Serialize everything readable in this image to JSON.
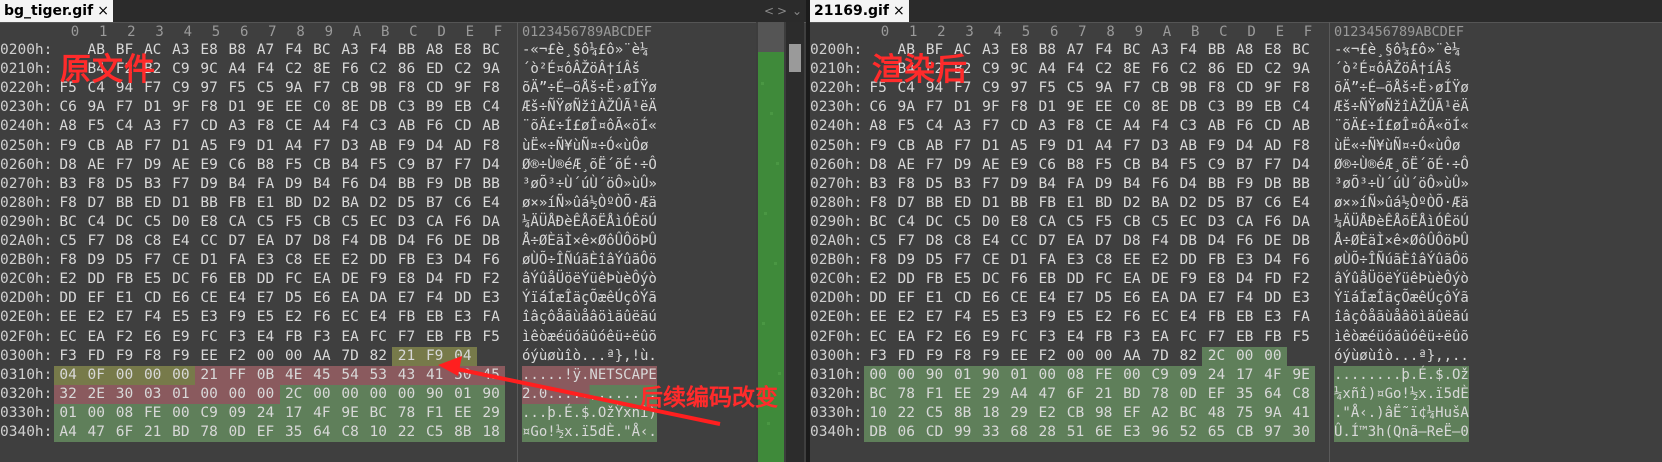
{
  "left": {
    "tab_label": "bg_tiger.gif",
    "tab_close": "×",
    "overlay_title": "原文件",
    "annotation": "后续编码改变",
    "controls": {
      "prev": "<",
      "next": ">",
      "menu": "⌄"
    },
    "col_headers": [
      "0",
      "1",
      "2",
      "3",
      "4",
      "5",
      "6",
      "7",
      "8",
      "9",
      "A",
      "B",
      "C",
      "D",
      "E",
      "F"
    ],
    "ascii_header": "0123456789ABCDEF",
    "rows": [
      {
        "off": "0200h:",
        "hex": [
          "AB",
          "BF",
          "AC",
          "A3",
          "E8",
          "B8",
          "A7",
          "F4",
          "BC",
          "A3",
          "F4",
          "BB",
          "A8",
          "E8",
          "BC"
        ],
        "ascii": "-«¬£è¸§ô¼£ô»¨è¼"
      },
      {
        "off": "0210h:",
        "hex": [
          "B4",
          "F2",
          "B2",
          "C9",
          "9C",
          "A4",
          "F4",
          "C2",
          "8E",
          "F6",
          "C2",
          "86",
          "ED",
          "C2",
          "9A"
        ],
        "ascii": "´ò²É­¤ôÂŽöÂ†íÂš"
      },
      {
        "off": "0220h:",
        "hex": [
          "F5",
          "C4",
          "94",
          "F7",
          "C9",
          "97",
          "F5",
          "C5",
          "9A",
          "F7",
          "CB",
          "9B",
          "F8",
          "CD",
          "9F",
          "F8"
        ],
        "ascii": "õÄ”÷É—õÅš÷Ë›øÍŸø"
      },
      {
        "off": "0230h:",
        "hex": [
          "C6",
          "9A",
          "F7",
          "D1",
          "9F",
          "F8",
          "D1",
          "9E",
          "EE",
          "C0",
          "8E",
          "DB",
          "C3",
          "B9",
          "EB",
          "C4"
        ],
        "ascii": "Æš÷ÑŸøÑžîÀŽÛÃ¹ëÄ"
      },
      {
        "off": "0240h:",
        "hex": [
          "A8",
          "F5",
          "C4",
          "A3",
          "F7",
          "CD",
          "A3",
          "F8",
          "CE",
          "A4",
          "F4",
          "C3",
          "AB",
          "F6",
          "CD",
          "AB"
        ],
        "ascii": "¨õÄ£÷Í£øÎ¤ôÃ«öÍ«"
      },
      {
        "off": "0250h:",
        "hex": [
          "F9",
          "CB",
          "AB",
          "F7",
          "D1",
          "A5",
          "F9",
          "D1",
          "A4",
          "F7",
          "D3",
          "AB",
          "F9",
          "D4",
          "AD",
          "F8"
        ],
        "ascii": "ùË«÷Ñ¥ùÑ¤÷Ó«ùÔ­ø"
      },
      {
        "off": "0260h:",
        "hex": [
          "D8",
          "AE",
          "F7",
          "D9",
          "AE",
          "E9",
          "C6",
          "B8",
          "F5",
          "CB",
          "B4",
          "F5",
          "C9",
          "B7",
          "F7",
          "D4"
        ],
        "ascii": "Ø®÷Ù®éÆ¸õË´õÉ·÷Ô"
      },
      {
        "off": "0270h:",
        "hex": [
          "B3",
          "F8",
          "D5",
          "B3",
          "F7",
          "D9",
          "B4",
          "FA",
          "D9",
          "B4",
          "F6",
          "D4",
          "BB",
          "F9",
          "DB",
          "BB"
        ],
        "ascii": "³øÕ³÷Ù´úÙ´öÔ»ùÛ»"
      },
      {
        "off": "0280h:",
        "hex": [
          "F8",
          "D7",
          "BB",
          "ED",
          "D1",
          "BB",
          "FB",
          "E1",
          "BD",
          "D2",
          "BA",
          "D2",
          "D5",
          "B7",
          "C6",
          "E4"
        ],
        "ascii": "ø×»íÑ»ûá½ÒºÒÕ·Æä"
      },
      {
        "off": "0290h:",
        "hex": [
          "BC",
          "C4",
          "DC",
          "C5",
          "D0",
          "E8",
          "CA",
          "C5",
          "F5",
          "CB",
          "C5",
          "EC",
          "D3",
          "CA",
          "F6",
          "DA"
        ],
        "ascii": "¼ÄÜÅÐèÊÅõËÅìÓÊöÚ"
      },
      {
        "off": "02A0h:",
        "hex": [
          "C5",
          "F7",
          "D8",
          "C8",
          "E4",
          "CC",
          "D7",
          "EA",
          "D7",
          "D8",
          "F4",
          "DB",
          "D4",
          "F6",
          "DE",
          "DB"
        ],
        "ascii": "Å÷ØÈäÌ×ê×ØôÛÔöÞÛ"
      },
      {
        "off": "02B0h:",
        "hex": [
          "F8",
          "D9",
          "D5",
          "F7",
          "CE",
          "D1",
          "FA",
          "E3",
          "C8",
          "EE",
          "E2",
          "DD",
          "FB",
          "E3",
          "D4",
          "F6"
        ],
        "ascii": "øÙÕ÷ÎÑúãÈîâÝûãÔö"
      },
      {
        "off": "02C0h:",
        "hex": [
          "E2",
          "DD",
          "FB",
          "E5",
          "DC",
          "F6",
          "EB",
          "DD",
          "FC",
          "EA",
          "DE",
          "F9",
          "E8",
          "D4",
          "FD",
          "F2"
        ],
        "ascii": "âÝûåÜöëÝüêÞùèÔýò"
      },
      {
        "off": "02D0h:",
        "hex": [
          "DD",
          "EF",
          "E1",
          "CD",
          "E6",
          "CE",
          "E4",
          "E7",
          "D5",
          "E6",
          "EA",
          "DA",
          "E7",
          "F4",
          "DD",
          "E3"
        ],
        "ascii": "ÝïáÍæÎäçÕæêÚçôÝã"
      },
      {
        "off": "02E0h:",
        "hex": [
          "EE",
          "E2",
          "E7",
          "F4",
          "E5",
          "E3",
          "F9",
          "E5",
          "E2",
          "F6",
          "EC",
          "E4",
          "FB",
          "EB",
          "E3",
          "FA"
        ],
        "ascii": "îâçôåãùåâöìäûëãú"
      },
      {
        "off": "02F0h:",
        "hex": [
          "EC",
          "EA",
          "F2",
          "E6",
          "E9",
          "FC",
          "F3",
          "E4",
          "FB",
          "F3",
          "EA",
          "FC",
          "F7",
          "EB",
          "FB",
          "F5"
        ],
        "ascii": "ìêòæéüóäûóêü÷ëûõ"
      },
      {
        "off": "0300h:",
        "hex": [
          "F3",
          "FD",
          "F9",
          "F8",
          "F9",
          "EE",
          "F2",
          "00",
          "00",
          "AA",
          "7D",
          "82",
          "21",
          "F9",
          "04"
        ],
        "ascii": "óýùøùîò...ª}‚!ù."
      },
      {
        "off": "0310h:",
        "hex": [
          "04",
          "0F",
          "00",
          "00",
          "00",
          "21",
          "FF",
          "0B",
          "4E",
          "45",
          "54",
          "53",
          "43",
          "41",
          "50",
          "45"
        ],
        "ascii": ".....!ÿ.NETSCAPE"
      },
      {
        "off": "0320h:",
        "hex": [
          "32",
          "2E",
          "30",
          "03",
          "01",
          "00",
          "00",
          "00",
          "2C",
          "00",
          "00",
          "00",
          "00",
          "90",
          "01",
          "90"
        ],
        "ascii": "2.0.....,......."
      },
      {
        "off": "0330h:",
        "hex": [
          "01",
          "00",
          "08",
          "FE",
          "00",
          "C9",
          "09",
          "24",
          "17",
          "4F",
          "9E",
          "BC",
          "78",
          "F1",
          "EE",
          "29"
        ],
        "ascii": "...þ.É.$.OžŸxñî)"
      },
      {
        "off": "0340h:",
        "hex": [
          "A4",
          "47",
          "6F",
          "21",
          "BD",
          "78",
          "0D",
          "EF",
          "35",
          "64",
          "C8",
          "10",
          "22",
          "C5",
          "8B",
          "18"
        ],
        "ascii": "¤Go!½x.ï5dÈ.\"Å‹."
      }
    ]
  },
  "right": {
    "tab_label": "21169.gif",
    "tab_close": "×",
    "overlay_title": "渲染后",
    "col_headers": [
      "0",
      "1",
      "2",
      "3",
      "4",
      "5",
      "6",
      "7",
      "8",
      "9",
      "A",
      "B",
      "C",
      "D",
      "E",
      "F"
    ],
    "ascii_header": "0123456789ABCDEF",
    "rows": [
      {
        "off": "0200h:",
        "hex": [
          "AB",
          "BF",
          "AC",
          "A3",
          "E8",
          "B8",
          "A7",
          "F4",
          "BC",
          "A3",
          "F4",
          "BB",
          "A8",
          "E8",
          "BC"
        ],
        "ascii": "-«¬£è¸§ô¼£ô»¨è¼"
      },
      {
        "off": "0210h:",
        "hex": [
          "B4",
          "F2",
          "B2",
          "C9",
          "9C",
          "A4",
          "F4",
          "C2",
          "8E",
          "F6",
          "C2",
          "86",
          "ED",
          "C2",
          "9A"
        ],
        "ascii": "´ò²É­¤ôÂŽöÂ†íÂš"
      },
      {
        "off": "0220h:",
        "hex": [
          "F5",
          "C4",
          "94",
          "F7",
          "C9",
          "97",
          "F5",
          "C5",
          "9A",
          "F7",
          "CB",
          "9B",
          "F8",
          "CD",
          "9F",
          "F8"
        ],
        "ascii": "õÄ”÷É—õÅš÷Ë›øÍŸø"
      },
      {
        "off": "0230h:",
        "hex": [
          "C6",
          "9A",
          "F7",
          "D1",
          "9F",
          "F8",
          "D1",
          "9E",
          "EE",
          "C0",
          "8E",
          "DB",
          "C3",
          "B9",
          "EB",
          "C4"
        ],
        "ascii": "Æš÷ÑŸøÑžîÀŽÛÃ¹ëÄ"
      },
      {
        "off": "0240h:",
        "hex": [
          "A8",
          "F5",
          "C4",
          "A3",
          "F7",
          "CD",
          "A3",
          "F8",
          "CE",
          "A4",
          "F4",
          "C3",
          "AB",
          "F6",
          "CD",
          "AB"
        ],
        "ascii": "¨õÄ£÷Í£øÎ¤ôÃ«öÍ«"
      },
      {
        "off": "0250h:",
        "hex": [
          "F9",
          "CB",
          "AB",
          "F7",
          "D1",
          "A5",
          "F9",
          "D1",
          "A4",
          "F7",
          "D3",
          "AB",
          "F9",
          "D4",
          "AD",
          "F8"
        ],
        "ascii": "ùË«÷Ñ¥ùÑ¤÷Ó«ùÔ­ø"
      },
      {
        "off": "0260h:",
        "hex": [
          "D8",
          "AE",
          "F7",
          "D9",
          "AE",
          "E9",
          "C6",
          "B8",
          "F5",
          "CB",
          "B4",
          "F5",
          "C9",
          "B7",
          "F7",
          "D4"
        ],
        "ascii": "Ø®÷Ù®éÆ¸õË´õÉ·÷Ô"
      },
      {
        "off": "0270h:",
        "hex": [
          "B3",
          "F8",
          "D5",
          "B3",
          "F7",
          "D9",
          "B4",
          "FA",
          "D9",
          "B4",
          "F6",
          "D4",
          "BB",
          "F9",
          "DB",
          "BB"
        ],
        "ascii": "³øÕ³÷Ù´úÙ´öÔ»ùÛ»"
      },
      {
        "off": "0280h:",
        "hex": [
          "F8",
          "D7",
          "BB",
          "ED",
          "D1",
          "BB",
          "FB",
          "E1",
          "BD",
          "D2",
          "BA",
          "D2",
          "D5",
          "B7",
          "C6",
          "E4"
        ],
        "ascii": "ø×»íÑ»ûá½ÒºÒÕ·Æä"
      },
      {
        "off": "0290h:",
        "hex": [
          "BC",
          "C4",
          "DC",
          "C5",
          "D0",
          "E8",
          "CA",
          "C5",
          "F5",
          "CB",
          "C5",
          "EC",
          "D3",
          "CA",
          "F6",
          "DA"
        ],
        "ascii": "¼ÄÜÅÐèÊÅõËÅìÓÊöÚ"
      },
      {
        "off": "02A0h:",
        "hex": [
          "C5",
          "F7",
          "D8",
          "C8",
          "E4",
          "CC",
          "D7",
          "EA",
          "D7",
          "D8",
          "F4",
          "DB",
          "D4",
          "F6",
          "DE",
          "DB"
        ],
        "ascii": "Å÷ØÈäÌ×ê×ØôÛÔöÞÛ"
      },
      {
        "off": "02B0h:",
        "hex": [
          "F8",
          "D9",
          "D5",
          "F7",
          "CE",
          "D1",
          "FA",
          "E3",
          "C8",
          "EE",
          "E2",
          "DD",
          "FB",
          "E3",
          "D4",
          "F6"
        ],
        "ascii": "øÙÕ÷ÎÑúãÈîâÝûãÔö"
      },
      {
        "off": "02C0h:",
        "hex": [
          "E2",
          "DD",
          "FB",
          "E5",
          "DC",
          "F6",
          "EB",
          "DD",
          "FC",
          "EA",
          "DE",
          "F9",
          "E8",
          "D4",
          "FD",
          "F2"
        ],
        "ascii": "âÝûåÜöëÝüêÞùèÔýò"
      },
      {
        "off": "02D0h:",
        "hex": [
          "DD",
          "EF",
          "E1",
          "CD",
          "E6",
          "CE",
          "E4",
          "E7",
          "D5",
          "E6",
          "EA",
          "DA",
          "E7",
          "F4",
          "DD",
          "E3"
        ],
        "ascii": "ÝïáÍæÎäçÕæêÚçôÝã"
      },
      {
        "off": "02E0h:",
        "hex": [
          "EE",
          "E2",
          "E7",
          "F4",
          "E5",
          "E3",
          "F9",
          "E5",
          "E2",
          "F6",
          "EC",
          "E4",
          "FB",
          "EB",
          "E3",
          "FA"
        ],
        "ascii": "îâçôåãùåâöìäûëãú"
      },
      {
        "off": "02F0h:",
        "hex": [
          "EC",
          "EA",
          "F2",
          "E6",
          "E9",
          "FC",
          "F3",
          "E4",
          "FB",
          "F3",
          "EA",
          "FC",
          "F7",
          "EB",
          "FB",
          "F5"
        ],
        "ascii": "ìêòæéüóäûóêü÷ëûõ"
      },
      {
        "off": "0300h:",
        "hex": [
          "F3",
          "FD",
          "F9",
          "F8",
          "F9",
          "EE",
          "F2",
          "00",
          "00",
          "AA",
          "7D",
          "82",
          "2C",
          "00",
          "00"
        ],
        "ascii": "óýùøùîò...ª}‚,.."
      },
      {
        "off": "0310h:",
        "hex": [
          "00",
          "00",
          "90",
          "01",
          "90",
          "01",
          "00",
          "08",
          "FE",
          "00",
          "C9",
          "09",
          "24",
          "17",
          "4F",
          "9E"
        ],
        "ascii": "........þ.É.$.Ož"
      },
      {
        "off": "0320h:",
        "hex": [
          "BC",
          "78",
          "F1",
          "EE",
          "29",
          "A4",
          "47",
          "6F",
          "21",
          "BD",
          "78",
          "0D",
          "EF",
          "35",
          "64",
          "C8"
        ],
        "ascii": "¼xñî)¤Go!½x.ï5dÈ"
      },
      {
        "off": "0330h:",
        "hex": [
          "10",
          "22",
          "C5",
          "8B",
          "18",
          "29",
          "E2",
          "CB",
          "98",
          "EF",
          "A2",
          "BC",
          "48",
          "75",
          "9A",
          "41"
        ],
        "ascii": ".\"Å‹.)âË˜ï¢¼HušA"
      },
      {
        "off": "0340h:",
        "hex": [
          "DB",
          "06",
          "CD",
          "99",
          "33",
          "68",
          "28",
          "51",
          "6E",
          "E3",
          "96",
          "52",
          "65",
          "CB",
          "97",
          "30"
        ],
        "ascii": "Û.Í™3h(Qnã–ReË—0"
      }
    ]
  },
  "colors": {
    "annotation_red": "#ff2b2b",
    "highlight_yellow": "#777a4a",
    "highlight_red": "#8a5a5e",
    "highlight_green": "#5f7f5a"
  }
}
